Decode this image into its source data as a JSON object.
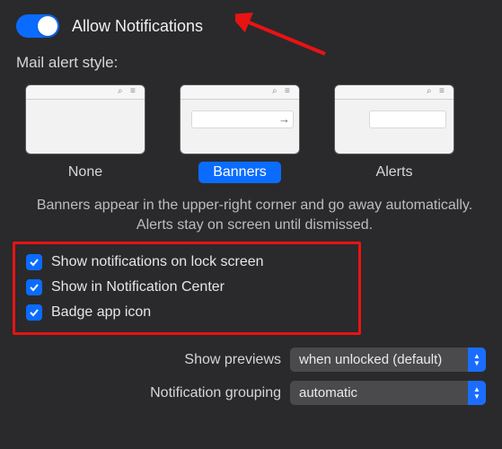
{
  "header": {
    "allow_label": "Allow Notifications"
  },
  "alert_style": {
    "section_label": "Mail alert style:",
    "options": {
      "none": "None",
      "banners": "Banners",
      "alerts": "Alerts"
    },
    "selected": "banners",
    "description": "Banners appear in the upper-right corner and go away automatically. Alerts stay on screen until dismissed."
  },
  "checkboxes": {
    "lock_screen": "Show notifications on lock screen",
    "notif_center": "Show in Notification Center",
    "badge": "Badge app icon"
  },
  "selects": {
    "previews_label": "Show previews",
    "previews_value": "when unlocked (default)",
    "grouping_label": "Notification grouping",
    "grouping_value": "automatic"
  },
  "colors": {
    "accent": "#0a6cff",
    "highlight": "#e81313"
  }
}
